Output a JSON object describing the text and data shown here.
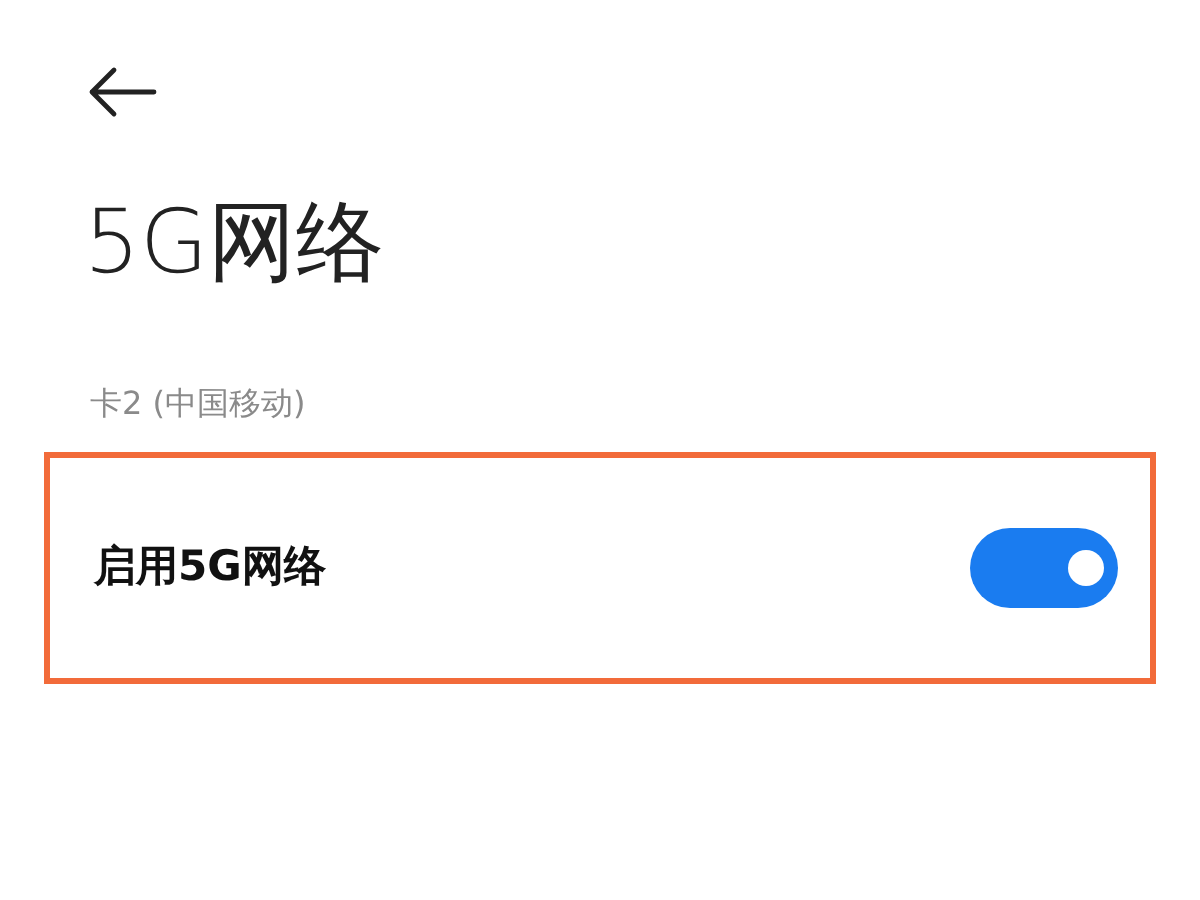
{
  "title": "5G网络",
  "section_label": "卡2 (中国移动)",
  "setting": {
    "label": "启用5G网络",
    "on": true,
    "highlighted": true
  }
}
